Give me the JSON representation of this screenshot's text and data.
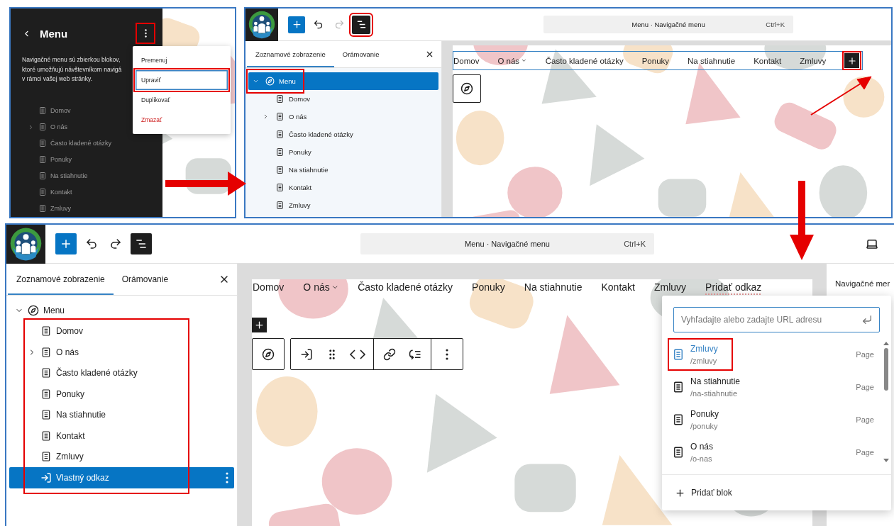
{
  "navigation_panel": {
    "title": "Menu",
    "more_button_annotated": true,
    "description": [
      "Navigačné menu sú zbierkou blokov,",
      "ktoré umožňujú návštevníkom navigá",
      "v rámci vašej web stránky."
    ],
    "items": [
      {
        "label": "Domov",
        "collapsible": false
      },
      {
        "label": "O nás",
        "collapsible": true
      },
      {
        "label": "Často kladené otázky",
        "collapsible": false
      },
      {
        "label": "Ponuky",
        "collapsible": false
      },
      {
        "label": "Na stiahnutie",
        "collapsible": false
      },
      {
        "label": "Kontakt",
        "collapsible": false
      },
      {
        "label": "Zmluvy",
        "collapsible": false
      }
    ],
    "dropdown": [
      {
        "label": "Premenuj",
        "kind": "normal",
        "focused": false,
        "annotated": false
      },
      {
        "label": "Upraviť",
        "kind": "normal",
        "focused": true,
        "annotated": true
      },
      {
        "label": "Duplikovať",
        "kind": "normal",
        "focused": false,
        "annotated": false
      },
      {
        "label": "Zmazať",
        "kind": "destructive",
        "focused": false,
        "annotated": false
      }
    ]
  },
  "list_view_editor": {
    "redo_disabled": true,
    "list_view_annotated": true,
    "command": {
      "title": "Menu · Navigačné menu",
      "shortcut": "Ctrl+K"
    },
    "tabs": [
      {
        "label": "Zoznamové zobrazenie",
        "selected": true
      },
      {
        "label": "Orámovanie",
        "selected": false
      }
    ],
    "tree": {
      "label": "Menu",
      "expanded": true,
      "selected": true,
      "annotated": true,
      "children": [
        {
          "label": "Domov",
          "kind": "page",
          "collapsible": false,
          "selected": false
        },
        {
          "label": "O nás",
          "kind": "page",
          "collapsible": true,
          "selected": false
        },
        {
          "label": "Často kladené otázky",
          "kind": "page",
          "collapsible": false,
          "selected": false
        },
        {
          "label": "Ponuky",
          "kind": "page",
          "collapsible": false,
          "selected": false
        },
        {
          "label": "Na stiahnutie",
          "kind": "page",
          "collapsible": false,
          "selected": false
        },
        {
          "label": "Kontakt",
          "kind": "page",
          "collapsible": false,
          "selected": false
        },
        {
          "label": "Zmluvy",
          "kind": "page",
          "collapsible": false,
          "selected": false
        }
      ]
    },
    "nav_links": [
      {
        "label": "Domov",
        "kind": "page",
        "has_submenu": false
      },
      {
        "label": "O nás",
        "kind": "page",
        "has_submenu": true
      },
      {
        "label": "Často kladené otázky",
        "kind": "page",
        "has_submenu": false
      },
      {
        "label": "Ponuky",
        "kind": "page",
        "has_submenu": false
      },
      {
        "label": "Na stiahnutie",
        "kind": "page",
        "has_submenu": false
      },
      {
        "label": "Kontakt",
        "kind": "page",
        "has_submenu": false
      },
      {
        "label": "Zmluvy",
        "kind": "page",
        "has_submenu": false
      }
    ],
    "appender": {
      "annotated": true
    }
  },
  "link_editor": {
    "redo_disabled": false,
    "command": {
      "title": "Menu · Navigačné menu",
      "shortcut": "Ctrl+K"
    },
    "tabs": [
      {
        "label": "Zoznamové zobrazenie",
        "selected": true
      },
      {
        "label": "Orámovanie",
        "selected": false
      }
    ],
    "tree": {
      "label": "Menu",
      "expanded": true,
      "selected": false,
      "children_annotated": true,
      "children": [
        {
          "label": "Domov",
          "kind": "page",
          "collapsible": false,
          "selected": false
        },
        {
          "label": "O nás",
          "kind": "page",
          "collapsible": true,
          "selected": false
        },
        {
          "label": "Často kladené otázky",
          "kind": "page",
          "collapsible": false,
          "selected": false
        },
        {
          "label": "Ponuky",
          "kind": "page",
          "collapsible": false,
          "selected": false
        },
        {
          "label": "Na stiahnutie",
          "kind": "page",
          "collapsible": false,
          "selected": false
        },
        {
          "label": "Kontakt",
          "kind": "page",
          "collapsible": false,
          "selected": false
        },
        {
          "label": "Zmluvy",
          "kind": "page",
          "collapsible": false,
          "selected": false
        },
        {
          "label": "Vlastný odkaz",
          "kind": "custom-link",
          "collapsible": false,
          "selected": true
        }
      ]
    },
    "nav_links": [
      {
        "label": "Domov",
        "kind": "page",
        "has_submenu": false
      },
      {
        "label": "O nás",
        "kind": "page",
        "has_submenu": true
      },
      {
        "label": "Často kladené otázky",
        "kind": "page",
        "has_submenu": false
      },
      {
        "label": "Ponuky",
        "kind": "page",
        "has_submenu": false
      },
      {
        "label": "Na stiahnutie",
        "kind": "page",
        "has_submenu": false
      },
      {
        "label": "Kontakt",
        "kind": "page",
        "has_submenu": false
      },
      {
        "label": "Zmluvy",
        "kind": "page",
        "has_submenu": false
      },
      {
        "label": "Pridať odkaz",
        "kind": "placeholder",
        "has_submenu": false
      }
    ],
    "settings_title": "Navigačné mer",
    "link_search": {
      "placeholder": "Vyhľadajte alebo zadajte URL adresu",
      "results": [
        {
          "title": "Zmluvy",
          "url": "/zmluvy",
          "type": "Page",
          "selected": true,
          "annotated": true
        },
        {
          "title": "Na stiahnutie",
          "url": "/na-stiahnutie",
          "type": "Page",
          "selected": false,
          "annotated": false
        },
        {
          "title": "Ponuky",
          "url": "/ponuky",
          "type": "Page",
          "selected": false,
          "annotated": false
        },
        {
          "title": "O nás",
          "url": "/o-nas",
          "type": "Page",
          "selected": false,
          "annotated": false
        }
      ],
      "add_block": "Pridať blok"
    }
  }
}
